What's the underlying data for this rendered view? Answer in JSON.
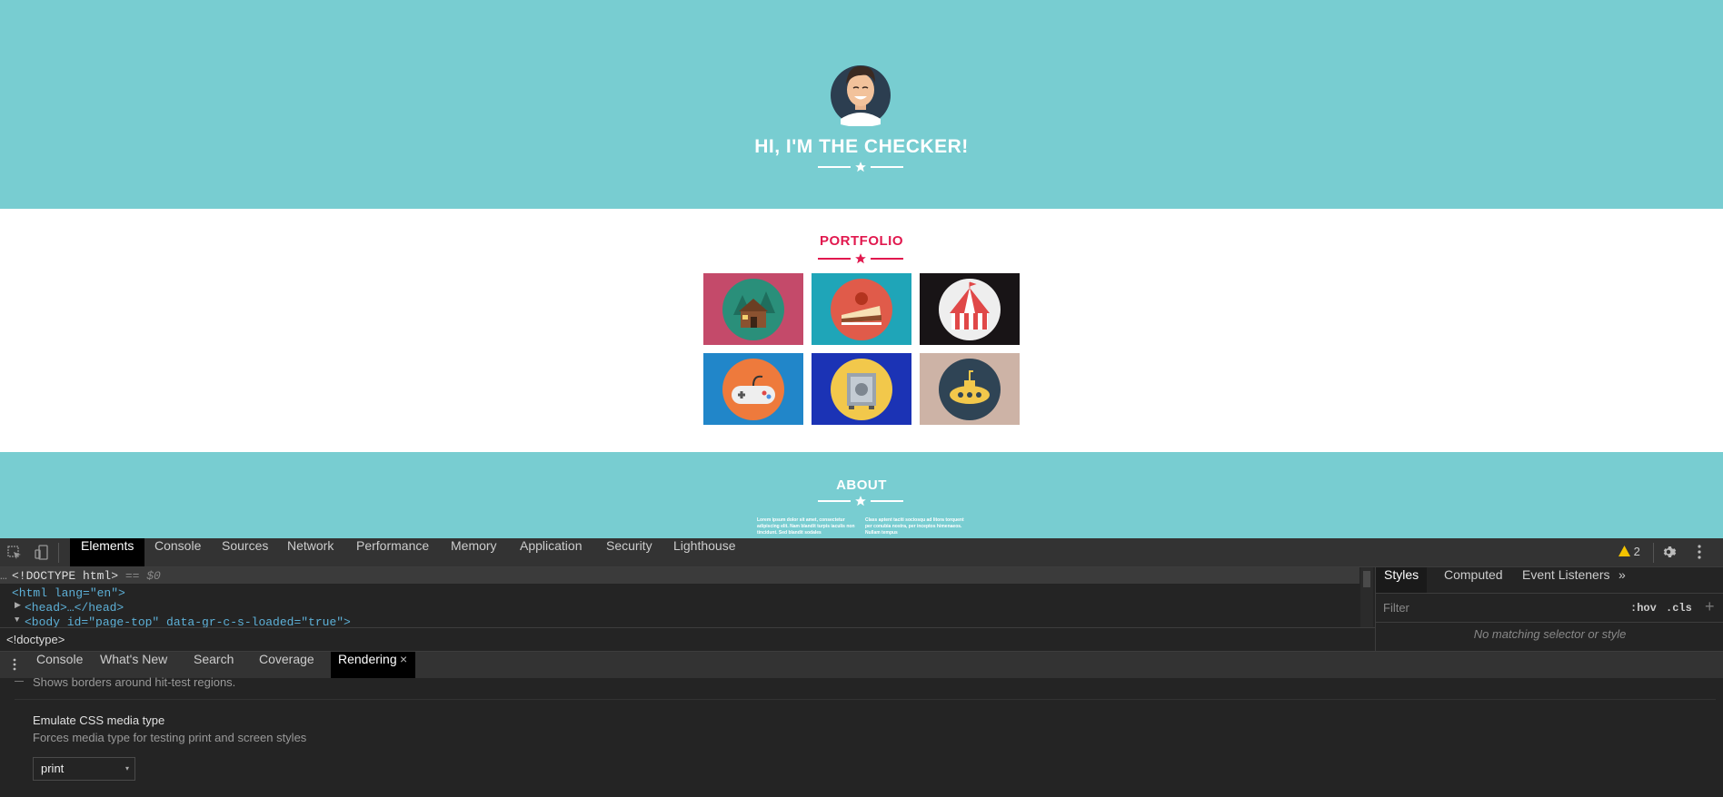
{
  "page": {
    "hero_title": "HI, I'M THE CHECKER!",
    "portfolio_title": "PORTFOLIO",
    "about_title": "ABOUT",
    "about_left": "Lorem ipsum dolor sit amet, consectetur adipiscing elit. Nam blandit turpis iaculis non tincidunt. Sed blandit sodales",
    "about_right": "Class aptent taciti sociosqu ad litora torquent per conubia nostra, per inceptos himenaeos. Nullam tempus",
    "colors": {
      "hero_bg": "#78cdd1",
      "accent": "#e1184e"
    },
    "portfolio_items": [
      {
        "icon": "cabin-icon",
        "bg": "#c44a6a"
      },
      {
        "icon": "cake-icon",
        "bg": "#1fa5b8"
      },
      {
        "icon": "circus-tent-icon",
        "bg": "#181416"
      },
      {
        "icon": "game-controller-icon",
        "bg": "#2186c9"
      },
      {
        "icon": "safe-icon",
        "bg": "#1b33b5"
      },
      {
        "icon": "submarine-icon",
        "bg": "#cdb3a6"
      }
    ]
  },
  "devtools": {
    "tabs": [
      "Elements",
      "Console",
      "Sources",
      "Network",
      "Performance",
      "Memory",
      "Application",
      "Security",
      "Lighthouse"
    ],
    "active_tab": "Elements",
    "warning_count": "2",
    "code": {
      "doctype": "<!DOCTYPE html>",
      "doctype_suffix": " == $0",
      "html_open": "<html lang=\"en\">",
      "head": "<head>…</head>",
      "body_partial": "<body id=\"page-top\" data-gr-c-s-loaded=\"true\">"
    },
    "breadcrumb": "<!doctype>",
    "styles_tabs": [
      "Styles",
      "Computed",
      "Event Listeners"
    ],
    "styles_more": "»",
    "filter_placeholder": "Filter",
    "hov": ":hov",
    "cls": ".cls",
    "no_match": "No matching selector or style",
    "drawer_tabs": [
      "Console",
      "What's New",
      "Search",
      "Coverage",
      "Rendering"
    ],
    "drawer_close": "×",
    "rendering": {
      "partial_desc": "Shows borders around hit-test regions.",
      "emulate_title": "Emulate CSS media type",
      "emulate_desc": "Forces media type for testing print and screen styles",
      "media_value": "print"
    }
  }
}
